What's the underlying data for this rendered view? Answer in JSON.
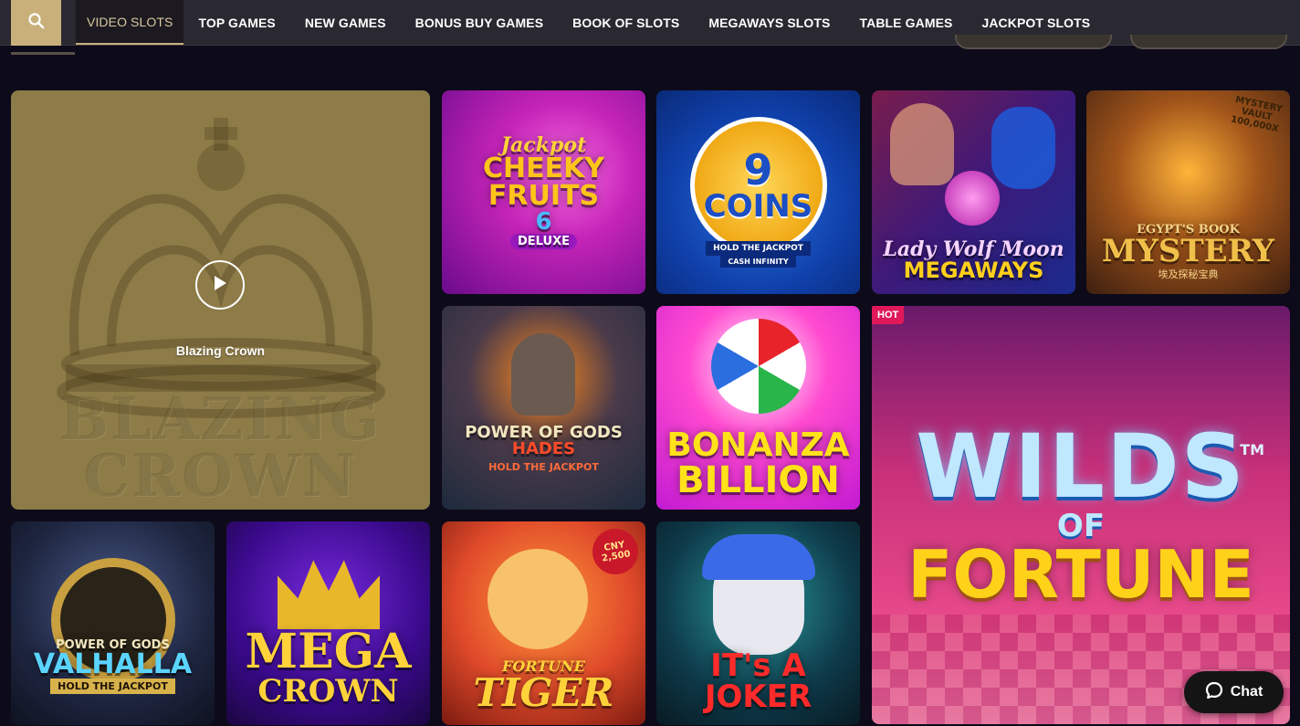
{
  "nav": {
    "search_icon": "search-icon",
    "tabs": [
      {
        "label": "VIDEO SLOTS",
        "active": true
      },
      {
        "label": "TOP GAMES"
      },
      {
        "label": "NEW GAMES"
      },
      {
        "label": "BONUS BUY GAMES"
      },
      {
        "label": "BOOK OF SLOTS"
      },
      {
        "label": "MEGAWAYS SLOTS"
      },
      {
        "label": "TABLE GAMES"
      },
      {
        "label": "JACKPOT SLOTS"
      }
    ]
  },
  "featured": {
    "label": "Blazing Crown",
    "bg_line1": "BLAZING",
    "bg_line2": "CROWN"
  },
  "games": {
    "cheeky": {
      "line1": "Jackpot",
      "line2": "CHEEKY",
      "line3": "FRUITS",
      "line4": "6",
      "line5": "DELUXE"
    },
    "coins": {
      "line1": "9",
      "line2": "COINS",
      "line3": "HOLD THE JACKPOT",
      "line4": "CASH INFINITY"
    },
    "lady": {
      "line1": "Lady Wolf Moon",
      "line2": "MEGAWAYS"
    },
    "mystery": {
      "line1": "MYSTERY",
      "line2": "VAULT",
      "line3": "100,000X",
      "line4": "EGYPT'S BOOK",
      "line5": "MYSTERY",
      "line6": "埃及探秘宝典"
    },
    "hades": {
      "line1": "POWER OF GODS",
      "line2": "HADES",
      "line3": "HOLD THE JACKPOT"
    },
    "bonanza": {
      "line1": "BONANZA",
      "line2": "BILLION"
    },
    "wilds": {
      "badge": "HOT",
      "line1": "WILDS",
      "line2": "OF",
      "line3": "FORTUNE",
      "tm": "TM"
    },
    "valhalla": {
      "line1": "POWER OF GODS",
      "line2": "VALHALLA",
      "line3": "HOLD THE JACKPOT"
    },
    "megacrown": {
      "line1": "MEGA",
      "line2": "CROWN"
    },
    "tiger": {
      "line1": "CNY",
      "line2": "2,500",
      "line3": "FORTUNE",
      "line4": "TIGER"
    },
    "joker": {
      "line1": "IT's A JOKER"
    }
  },
  "chat": {
    "label": "Chat"
  },
  "colors": {
    "accent": "#c9b07a",
    "hot": "#e0185a",
    "nav_bg": "#2a2830",
    "page_bg": "#0d0a1a"
  }
}
